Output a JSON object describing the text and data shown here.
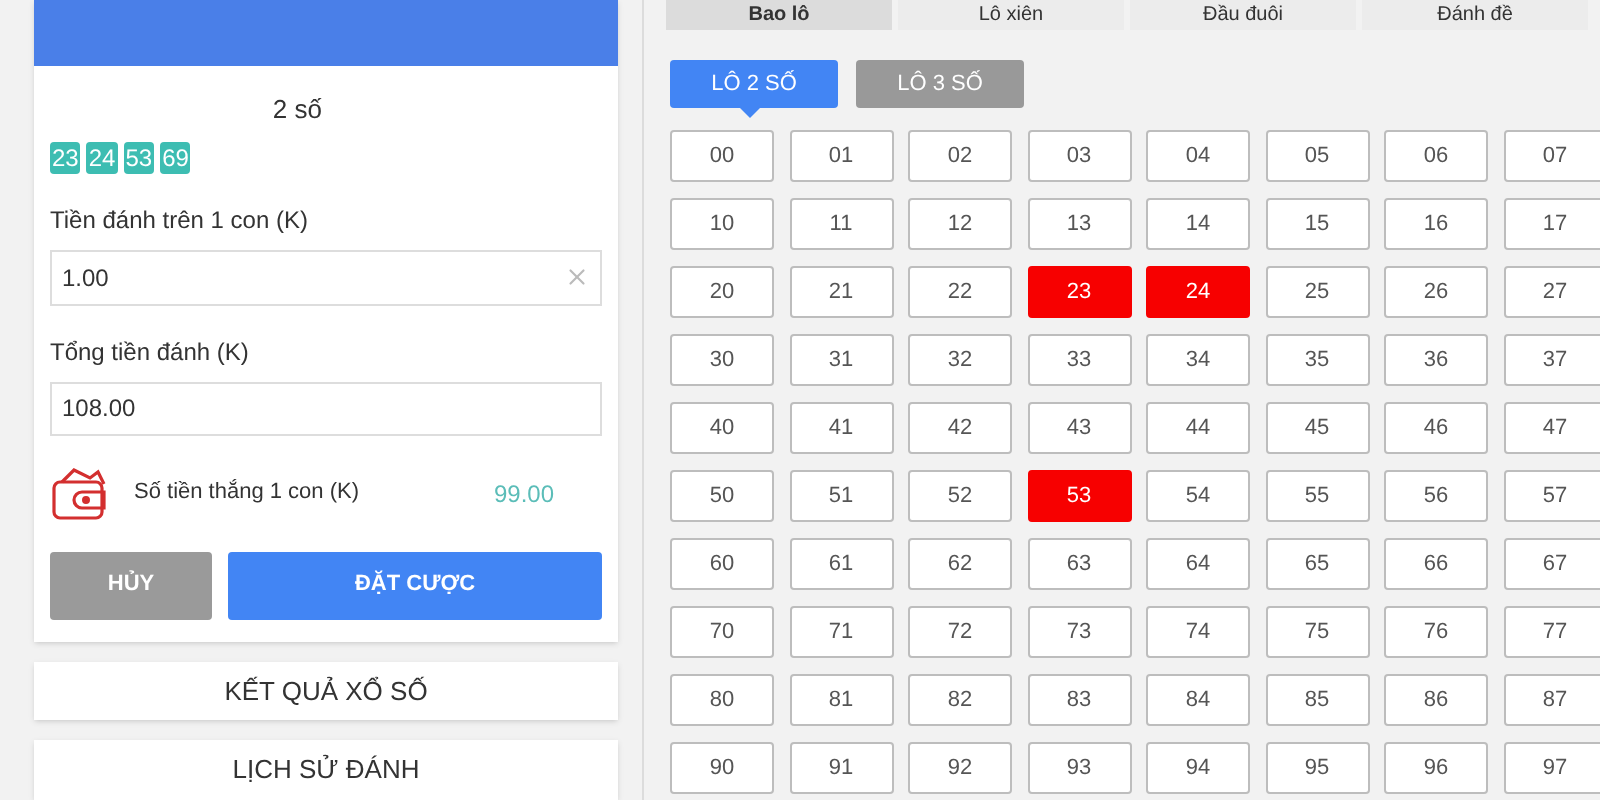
{
  "bet_panel": {
    "selection_label": "2 số",
    "chosen_numbers": [
      "23",
      "24",
      "53",
      "69"
    ],
    "stake_label": "Tiền đánh trên 1 con (K)",
    "stake_value": "1.00",
    "total_label": "Tổng tiền đánh (K)",
    "total_value": "108.00",
    "win_label": "Số tiền thắng 1 con (K)",
    "win_value": "99.00",
    "cancel_button": "HỦY",
    "place_button": "ĐẶT CƯỢC"
  },
  "links": [
    "KẾT QUẢ XỔ SỐ",
    "LỊCH SỬ ĐÁNH"
  ],
  "tabs": [
    {
      "label": "Bao lô",
      "selected": true
    },
    {
      "label": "Lô xiên",
      "selected": false
    },
    {
      "label": "Đầu đuôi",
      "selected": false
    },
    {
      "label": "Đánh đề",
      "selected": false
    }
  ],
  "sub_tabs": [
    {
      "label": "LÔ 2 SỐ",
      "selected": true
    },
    {
      "label": "LÔ 3 SỐ",
      "selected": false
    }
  ],
  "numbers": [
    {
      "label": "00",
      "selected": false
    },
    {
      "label": "01",
      "selected": false
    },
    {
      "label": "02",
      "selected": false
    },
    {
      "label": "03",
      "selected": false
    },
    {
      "label": "04",
      "selected": false
    },
    {
      "label": "05",
      "selected": false
    },
    {
      "label": "06",
      "selected": false
    },
    {
      "label": "07",
      "selected": false
    },
    {
      "label": "10",
      "selected": false
    },
    {
      "label": "11",
      "selected": false
    },
    {
      "label": "12",
      "selected": false
    },
    {
      "label": "13",
      "selected": false
    },
    {
      "label": "14",
      "selected": false
    },
    {
      "label": "15",
      "selected": false
    },
    {
      "label": "16",
      "selected": false
    },
    {
      "label": "17",
      "selected": false
    },
    {
      "label": "20",
      "selected": false
    },
    {
      "label": "21",
      "selected": false
    },
    {
      "label": "22",
      "selected": false
    },
    {
      "label": "23",
      "selected": true
    },
    {
      "label": "24",
      "selected": true
    },
    {
      "label": "25",
      "selected": false
    },
    {
      "label": "26",
      "selected": false
    },
    {
      "label": "27",
      "selected": false
    },
    {
      "label": "30",
      "selected": false
    },
    {
      "label": "31",
      "selected": false
    },
    {
      "label": "32",
      "selected": false
    },
    {
      "label": "33",
      "selected": false
    },
    {
      "label": "34",
      "selected": false
    },
    {
      "label": "35",
      "selected": false
    },
    {
      "label": "36",
      "selected": false
    },
    {
      "label": "37",
      "selected": false
    },
    {
      "label": "40",
      "selected": false
    },
    {
      "label": "41",
      "selected": false
    },
    {
      "label": "42",
      "selected": false
    },
    {
      "label": "43",
      "selected": false
    },
    {
      "label": "44",
      "selected": false
    },
    {
      "label": "45",
      "selected": false
    },
    {
      "label": "46",
      "selected": false
    },
    {
      "label": "47",
      "selected": false
    },
    {
      "label": "50",
      "selected": false
    },
    {
      "label": "51",
      "selected": false
    },
    {
      "label": "52",
      "selected": false
    },
    {
      "label": "53",
      "selected": true
    },
    {
      "label": "54",
      "selected": false
    },
    {
      "label": "55",
      "selected": false
    },
    {
      "label": "56",
      "selected": false
    },
    {
      "label": "57",
      "selected": false
    },
    {
      "label": "60",
      "selected": false
    },
    {
      "label": "61",
      "selected": false
    },
    {
      "label": "62",
      "selected": false
    },
    {
      "label": "63",
      "selected": false
    },
    {
      "label": "64",
      "selected": false
    },
    {
      "label": "65",
      "selected": false
    },
    {
      "label": "66",
      "selected": false
    },
    {
      "label": "67",
      "selected": false
    },
    {
      "label": "70",
      "selected": false
    },
    {
      "label": "71",
      "selected": false
    },
    {
      "label": "72",
      "selected": false
    },
    {
      "label": "73",
      "selected": false
    },
    {
      "label": "74",
      "selected": false
    },
    {
      "label": "75",
      "selected": false
    },
    {
      "label": "76",
      "selected": false
    },
    {
      "label": "77",
      "selected": false
    },
    {
      "label": "80",
      "selected": false
    },
    {
      "label": "81",
      "selected": false
    },
    {
      "label": "82",
      "selected": false
    },
    {
      "label": "83",
      "selected": false
    },
    {
      "label": "84",
      "selected": false
    },
    {
      "label": "85",
      "selected": false
    },
    {
      "label": "86",
      "selected": false
    },
    {
      "label": "87",
      "selected": false
    },
    {
      "label": "90",
      "selected": false
    },
    {
      "label": "91",
      "selected": false
    },
    {
      "label": "92",
      "selected": false
    },
    {
      "label": "93",
      "selected": false
    },
    {
      "label": "94",
      "selected": false
    },
    {
      "label": "95",
      "selected": false
    },
    {
      "label": "96",
      "selected": false
    },
    {
      "label": "97",
      "selected": false
    }
  ]
}
